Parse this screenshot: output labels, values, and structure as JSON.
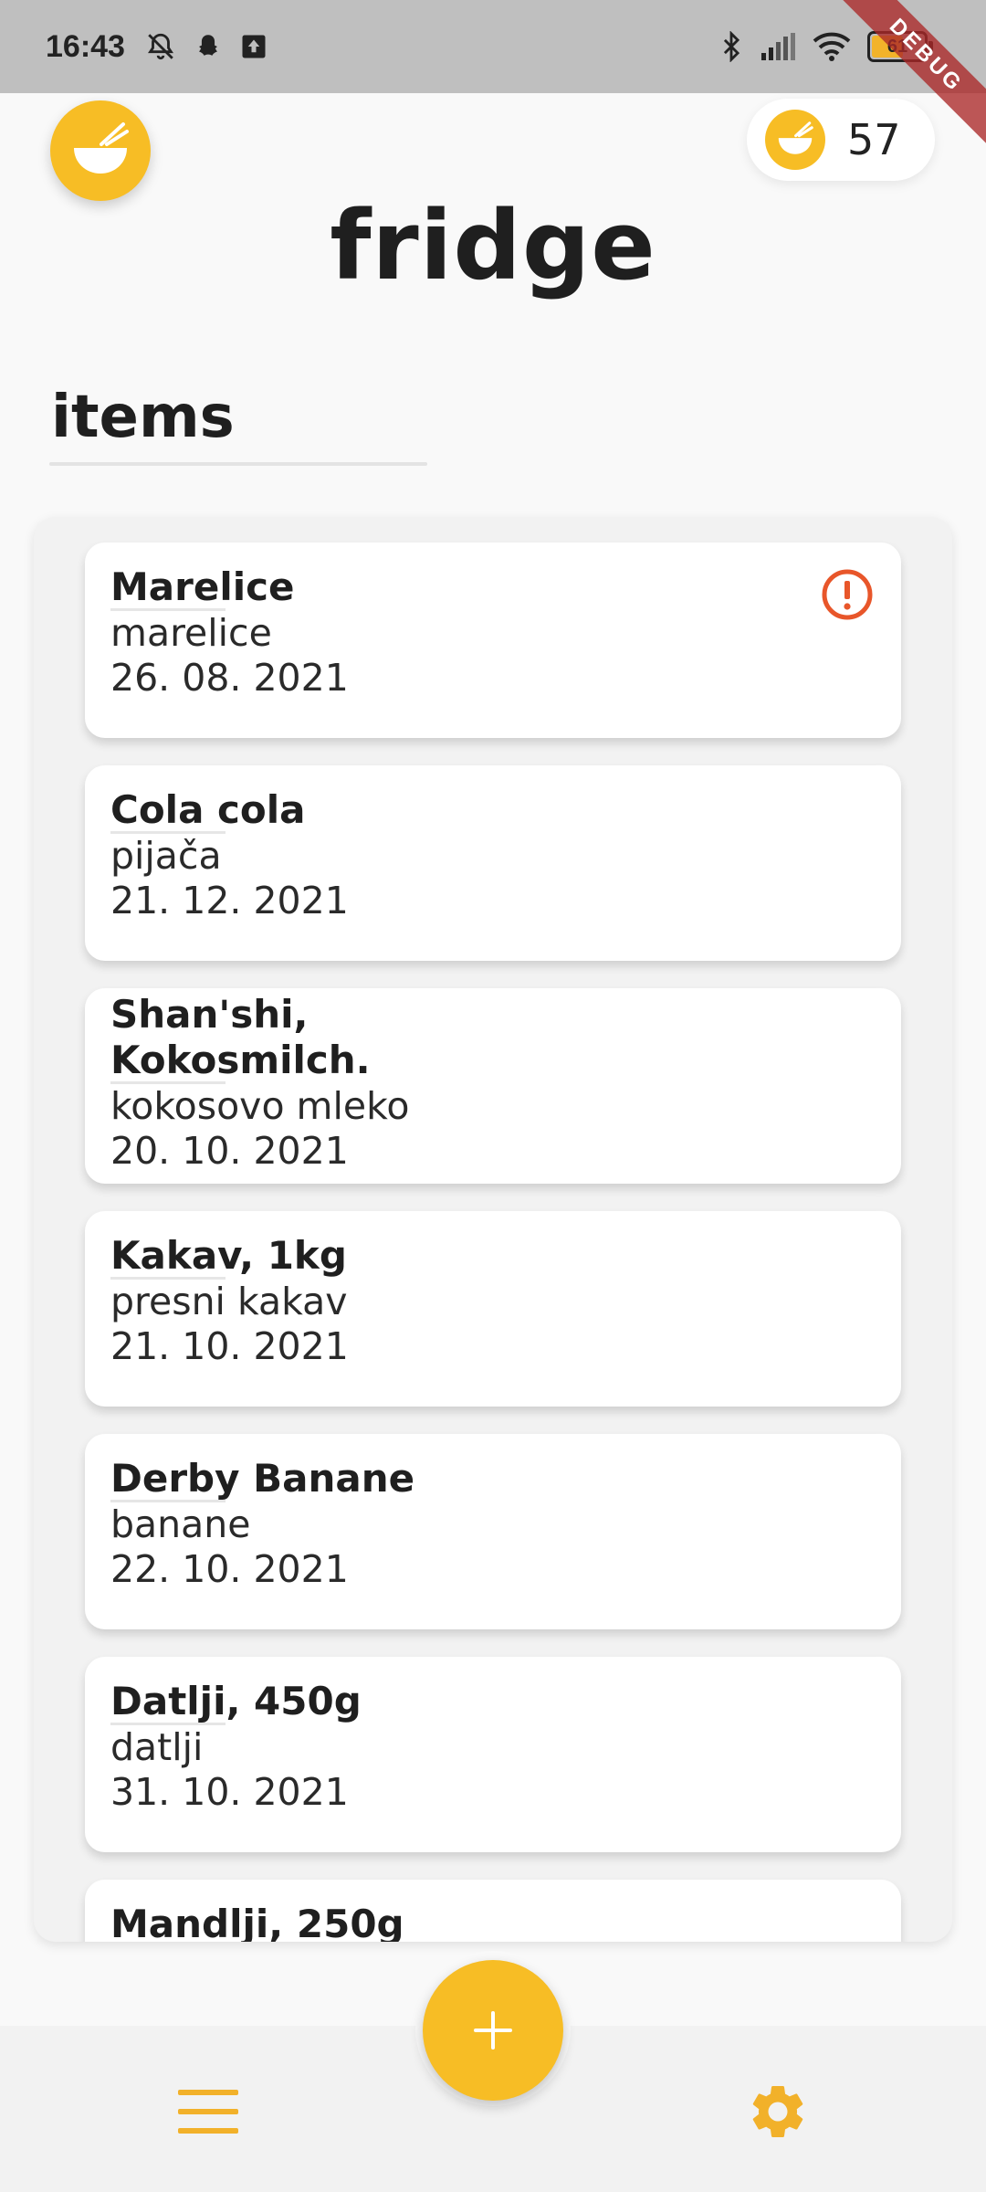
{
  "status_bar": {
    "time": "16:43",
    "battery_level": "61",
    "icons_left": [
      "notifications-off-icon",
      "snapchat-icon",
      "upload-icon"
    ],
    "icons_right": [
      "bluetooth-icon",
      "signal-icon",
      "wifi-icon",
      "battery-icon"
    ]
  },
  "debug_banner": "DEBUG",
  "header": {
    "logo_icon": "bowl-chopsticks-icon",
    "coin_icon": "bowl-chopsticks-icon",
    "coin_count": "57",
    "title": "fridge"
  },
  "section": {
    "title": "items"
  },
  "items": [
    {
      "name": "Marelice",
      "category": "marelice",
      "date": "26. 08. 2021",
      "alert": true
    },
    {
      "name": "Cola cola",
      "category": "pijača",
      "date": "21. 12. 2021",
      "alert": false
    },
    {
      "name": "Shan'shi, Kokosmilch.",
      "category": "kokosovo mleko",
      "date": "20. 10. 2021",
      "alert": false
    },
    {
      "name": "Kakav, 1kg",
      "category": "presni kakav",
      "date": "21. 10. 2021",
      "alert": false
    },
    {
      "name": "Derby Banane",
      "category": "banane",
      "date": "22. 10. 2021",
      "alert": false
    },
    {
      "name": "Datlji, 450g",
      "category": "datlji",
      "date": "31. 10. 2021",
      "alert": false
    },
    {
      "name": "Mandlji, 250g",
      "category": "",
      "date": "",
      "alert": false
    }
  ],
  "bottom_nav": {
    "add_label": "+",
    "menu_icon": "menu-icon",
    "settings_icon": "gear-icon"
  },
  "colors": {
    "accent": "#f7bd25",
    "alert": "#e8562a",
    "background": "#f9f9f9",
    "panel": "#f2f2f2",
    "card": "#ffffff"
  }
}
